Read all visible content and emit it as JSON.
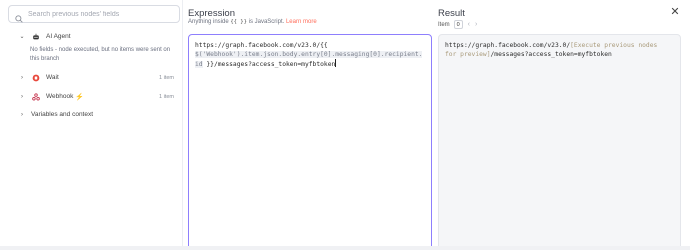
{
  "left_panel": {
    "search_placeholder": "Search previous nodes' fields",
    "nodes": [
      {
        "name": "AI Agent",
        "expanded": true,
        "icon": "robot-icon",
        "note": "No fields - node executed, but no items were sent on this branch"
      },
      {
        "name": "Wait",
        "expanded": false,
        "icon": "wait-icon",
        "count": "1 item"
      },
      {
        "name": "Webhook",
        "expanded": false,
        "icon": "webhook-icon",
        "count": "1 item",
        "trigger": "⚡"
      },
      {
        "name": "Variables and context",
        "expanded": false
      }
    ]
  },
  "expression": {
    "title": "Expression",
    "hint_prefix": "Anything inside",
    "hint_braces": "{{ }}",
    "hint_suffix": "is JavaScript.",
    "learn_more": "Learn more",
    "lines": [
      {
        "plain": "https://graph.facebook.com/v23.0/{{"
      },
      {
        "res": "$('Webhook').item.json.body.entry[0].messaging[0].recipient."
      },
      {
        "res": "id",
        "plain": " }}/messages?access_token=myfbtoken"
      }
    ]
  },
  "result": {
    "title": "Result",
    "item_label": "Item",
    "item_index": "0",
    "line1_plain": "https://graph.facebook.com/v23.0/",
    "line1_preview": "[Execute previous nodes",
    "line2_preview": "for preview]",
    "line2_plain": "/messages?access_token=myfbtoken"
  },
  "colors": {
    "accent": "#ff6d5a",
    "editor_border": "#8e7ffd"
  }
}
